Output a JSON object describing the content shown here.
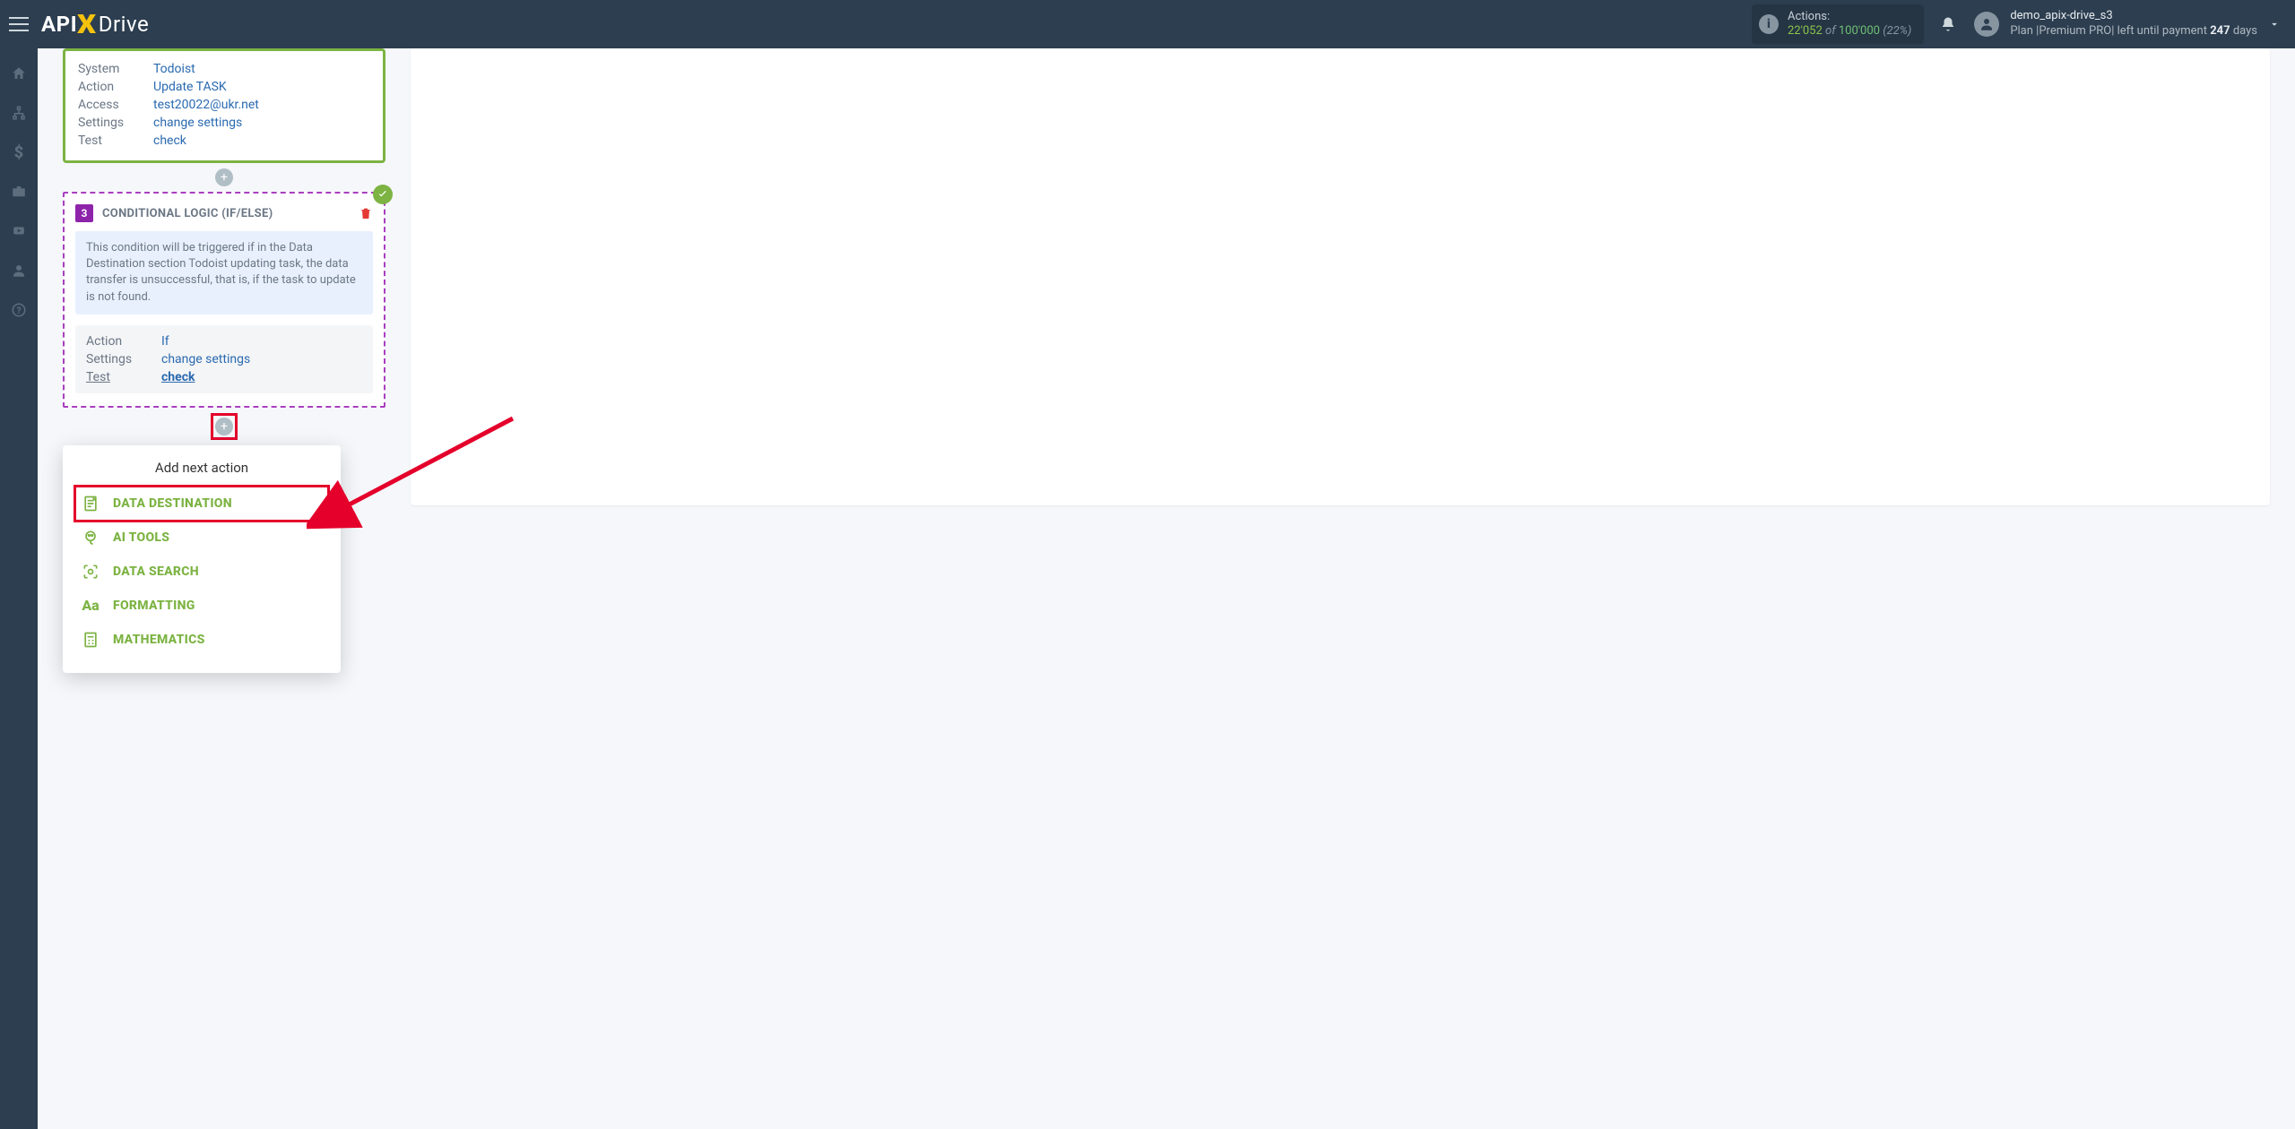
{
  "brand": {
    "api": "API",
    "x": "X",
    "drive": "Drive"
  },
  "header": {
    "actions_label": "Actions:",
    "actions_used": "22'052",
    "actions_of": "of",
    "actions_total": "100'000",
    "actions_pct": "(22%)",
    "username": "demo_apix-drive_s3",
    "plan_prefix": "Plan |",
    "plan_name": "Premium PRO",
    "plan_suffix1": "| left until payment ",
    "plan_days": "247",
    "plan_suffix2": " days"
  },
  "step2": {
    "rows": [
      {
        "k": "System",
        "v": "Todoist"
      },
      {
        "k": "Action",
        "v": "Update TASK"
      },
      {
        "k": "Access",
        "v": "test20022@ukr.net"
      },
      {
        "k": "Settings",
        "v": "change settings"
      },
      {
        "k": "Test",
        "v": "check"
      }
    ]
  },
  "cond": {
    "badge": "3",
    "title": "CONDITIONAL LOGIC (IF/ELSE)",
    "desc": "This condition will be triggered if in the Data Destination section Todoist updating task, the data transfer is unsuccessful, that is, if the task to update is not found.",
    "rows": [
      {
        "k": "Action",
        "v": "If"
      },
      {
        "k": "Settings",
        "v": "change settings"
      },
      {
        "k": "Test",
        "v": "check",
        "test": true
      }
    ]
  },
  "dropdown": {
    "title": "Add next action",
    "items": [
      {
        "label": "DATA DESTINATION",
        "icon": "doc",
        "hl": true
      },
      {
        "label": "AI TOOLS",
        "icon": "brain"
      },
      {
        "label": "DATA SEARCH",
        "icon": "scan"
      },
      {
        "label": "FORMATTING",
        "icon": "aa"
      },
      {
        "label": "MATHEMATICS",
        "icon": "calc"
      }
    ]
  },
  "rail_items": [
    "home",
    "sitemap",
    "dollar",
    "briefcase",
    "youtube",
    "user",
    "help"
  ]
}
